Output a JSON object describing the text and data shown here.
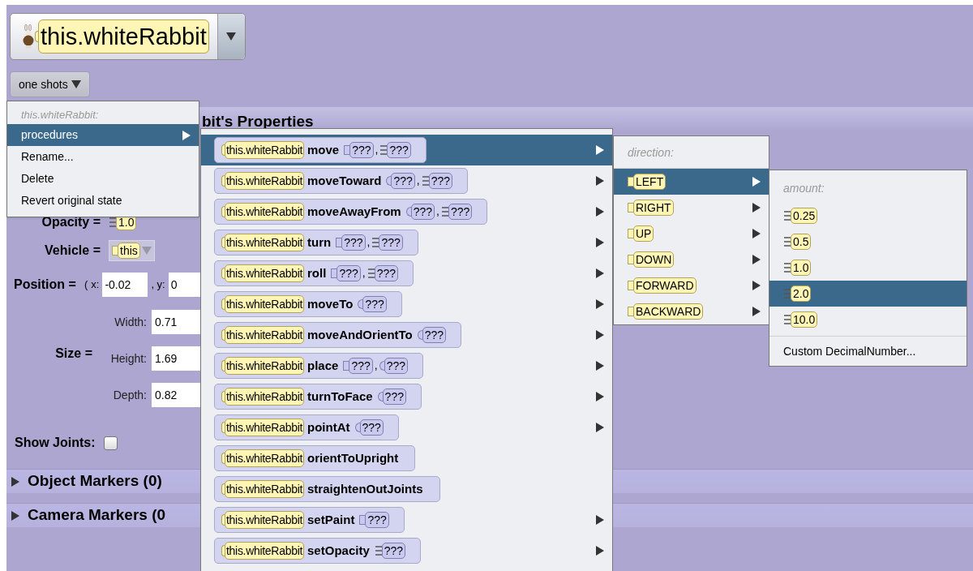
{
  "selector": {
    "label": "this.whiteRabbit"
  },
  "one_shots": {
    "label": "one shots"
  },
  "properties": {
    "title": "bit's Properties",
    "opacity": {
      "label": "Opacity =",
      "value": "1.0"
    },
    "vehicle": {
      "label": "Vehicle =",
      "value": "this"
    },
    "position": {
      "label": "Position =",
      "open": "(",
      "x_label": "x:",
      "x_value": "-0.02",
      "y_label": ", y:",
      "y_value": "0"
    },
    "size": {
      "label": "Size =",
      "fields": [
        {
          "label": "Width:",
          "value": "0.71"
        },
        {
          "label": "Height:",
          "value": "1.69"
        },
        {
          "label": "Depth:",
          "value": "0.82"
        }
      ]
    },
    "show_joints": {
      "label": "Show Joints:",
      "checked": false
    }
  },
  "sections": [
    {
      "label": "Object Markers (0)",
      "expanded": false
    },
    {
      "label": "Camera Markers (0",
      "expanded": false
    }
  ],
  "context_menu": {
    "header": "this.whiteRabbit:",
    "items": [
      {
        "label": "procedures",
        "selected": true,
        "submenu": true
      },
      {
        "label": "Rename...",
        "selected": false,
        "submenu": false
      },
      {
        "label": "Delete",
        "selected": false,
        "submenu": false
      },
      {
        "label": "Revert original state",
        "selected": false,
        "submenu": false
      }
    ]
  },
  "procedures_menu": {
    "items": [
      {
        "target": "this.whiteRabbit",
        "name": "move",
        "selected": true,
        "submenu": true,
        "params": [
          {
            "kind": "enum",
            "text": "???"
          },
          {
            "kind": "comma",
            "text": ","
          },
          {
            "kind": "number",
            "text": "???"
          }
        ]
      },
      {
        "target": "this.whiteRabbit",
        "name": "moveToward",
        "selected": false,
        "submenu": true,
        "params": [
          {
            "kind": "object",
            "text": "???"
          },
          {
            "kind": "comma",
            "text": ","
          },
          {
            "kind": "number",
            "text": "???"
          }
        ]
      },
      {
        "target": "this.whiteRabbit",
        "name": "moveAwayFrom",
        "selected": false,
        "submenu": true,
        "params": [
          {
            "kind": "object",
            "text": "???"
          },
          {
            "kind": "comma",
            "text": ","
          },
          {
            "kind": "number",
            "text": "???"
          }
        ]
      },
      {
        "target": "this.whiteRabbit",
        "name": "turn",
        "selected": false,
        "submenu": true,
        "params": [
          {
            "kind": "enum",
            "text": "???"
          },
          {
            "kind": "comma",
            "text": ","
          },
          {
            "kind": "number",
            "text": "???"
          }
        ]
      },
      {
        "target": "this.whiteRabbit",
        "name": "roll",
        "selected": false,
        "submenu": true,
        "params": [
          {
            "kind": "enum",
            "text": "???"
          },
          {
            "kind": "comma",
            "text": ","
          },
          {
            "kind": "number",
            "text": "???"
          }
        ]
      },
      {
        "target": "this.whiteRabbit",
        "name": "moveTo",
        "selected": false,
        "submenu": true,
        "params": [
          {
            "kind": "object",
            "text": "???"
          }
        ]
      },
      {
        "target": "this.whiteRabbit",
        "name": "moveAndOrientTo",
        "selected": false,
        "submenu": true,
        "params": [
          {
            "kind": "object",
            "text": "???"
          }
        ]
      },
      {
        "target": "this.whiteRabbit",
        "name": "place",
        "selected": false,
        "submenu": true,
        "params": [
          {
            "kind": "enum",
            "text": "???"
          },
          {
            "kind": "comma",
            "text": ","
          },
          {
            "kind": "object",
            "text": "???"
          }
        ]
      },
      {
        "target": "this.whiteRabbit",
        "name": "turnToFace",
        "selected": false,
        "submenu": true,
        "params": [
          {
            "kind": "object",
            "text": "???"
          }
        ]
      },
      {
        "target": "this.whiteRabbit",
        "name": "pointAt",
        "selected": false,
        "submenu": true,
        "params": [
          {
            "kind": "object",
            "text": "???"
          }
        ]
      },
      {
        "target": "this.whiteRabbit",
        "name": "orientToUpright",
        "selected": false,
        "submenu": false
      },
      {
        "target": "this.whiteRabbit",
        "name": "straightenOutJoints",
        "selected": false,
        "submenu": false
      },
      {
        "target": "this.whiteRabbit",
        "name": "setPaint",
        "selected": false,
        "submenu": true,
        "params": [
          {
            "kind": "enum",
            "text": "???"
          }
        ]
      },
      {
        "target": "this.whiteRabbit",
        "name": "setOpacity",
        "selected": false,
        "submenu": true,
        "params": [
          {
            "kind": "number",
            "text": "???"
          }
        ]
      }
    ]
  },
  "direction_menu": {
    "header": "direction:",
    "items": [
      {
        "label": "LEFT",
        "selected": true,
        "submenu": true
      },
      {
        "label": "RIGHT",
        "selected": false,
        "submenu": true
      },
      {
        "label": "UP",
        "selected": false,
        "submenu": true
      },
      {
        "label": "DOWN",
        "selected": false,
        "submenu": true
      },
      {
        "label": "FORWARD",
        "selected": false,
        "submenu": true
      },
      {
        "label": "BACKWARD",
        "selected": false,
        "submenu": true
      }
    ]
  },
  "amount_menu": {
    "header": "amount:",
    "items": [
      {
        "label": "0.25",
        "selected": false
      },
      {
        "label": "0.5",
        "selected": false
      },
      {
        "label": "1.0",
        "selected": false
      },
      {
        "label": "2.0",
        "selected": true
      },
      {
        "label": "10.0",
        "selected": false
      }
    ],
    "custom": "Custom DecimalNumber..."
  }
}
